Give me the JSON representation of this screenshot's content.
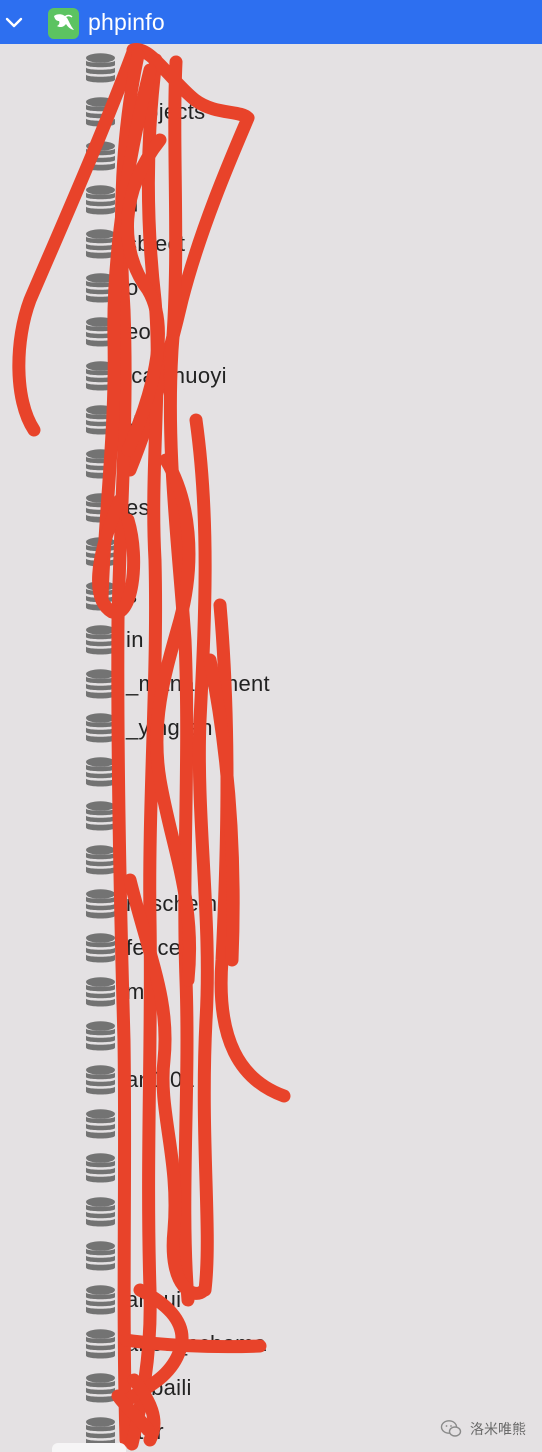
{
  "connection": {
    "name": "phpinfo",
    "icon": "mysql-dolphin-icon",
    "expanded": true,
    "colors": {
      "header_bg": "#2d6ff0",
      "icon_bg": "#5cc361"
    }
  },
  "databases": [
    "a",
    "projects",
    "",
    "q",
    "sbject",
    "o",
    "eo",
    "ical_huoyi",
    "yi",
    "",
    "es",
    "",
    "s",
    "in",
    "_management",
    "_yingren",
    "",
    "",
    "",
    "n_schema",
    "fence",
    "m",
    "",
    "an1 01",
    "",
    "",
    "",
    "",
    "anhui",
    "ance_schema",
    "ngbaili",
    "ster"
  ],
  "db_icon": "database-icon",
  "watermark": {
    "icon": "wechat-icon",
    "text": "洛米唯熊"
  },
  "scribble_color": "#e8432a"
}
